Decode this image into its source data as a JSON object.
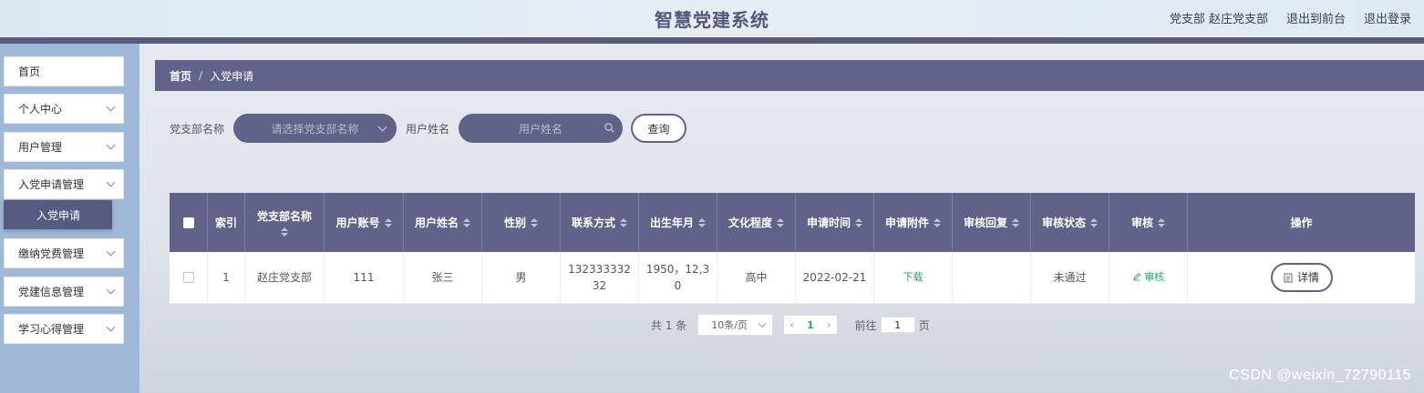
{
  "header": {
    "title": "智慧党建系统",
    "user": "党支部 赵庄党支部",
    "exit_front": "退出到前台",
    "logout": "退出登录"
  },
  "sidebar": {
    "items": [
      {
        "label": "首页"
      },
      {
        "label": "个人中心"
      },
      {
        "label": "用户管理"
      },
      {
        "label": "入党申请管理"
      },
      {
        "label": "缴纳党费管理"
      },
      {
        "label": "党建信息管理"
      },
      {
        "label": "学习心得管理"
      }
    ],
    "sub_active": "入党申请"
  },
  "breadcrumb": {
    "home": "首页",
    "sep": "/",
    "current": "入党申请"
  },
  "search": {
    "branch_label": "党支部名称",
    "branch_placeholder": "请选择党支部名称",
    "name_label": "用户姓名",
    "name_placeholder": "用户姓名",
    "query_label": "查询"
  },
  "table": {
    "headers": [
      "索引",
      "党支部名称",
      "用户账号",
      "用户姓名",
      "性别",
      "联系方式",
      "出生年月",
      "文化程度",
      "申请时间",
      "申请附件",
      "审核回复",
      "审核状态",
      "审核",
      "操作"
    ],
    "row": {
      "index": "1",
      "branch": "赵庄党支部",
      "account": "111",
      "name": "张三",
      "gender": "男",
      "phone_line1": "132333332",
      "phone_line2": "32",
      "birth_line1": "1950，12,3",
      "birth_line2": "0",
      "education": "高中",
      "apply_time": "2022-02-21",
      "attachment": "下载",
      "reply": "",
      "status": "未通过",
      "review": "审核",
      "detail": "详情"
    }
  },
  "pager": {
    "total": "共 1 条",
    "size": "10条/页",
    "current": "1",
    "goto_prefix": "前往",
    "goto_value": "1",
    "goto_suffix": "页"
  },
  "watermark": "CSDN @weixin_72790115",
  "colors": {
    "primary": "#5f6388",
    "sidebar": "#9fb8d7",
    "link": "#2aa36b"
  }
}
